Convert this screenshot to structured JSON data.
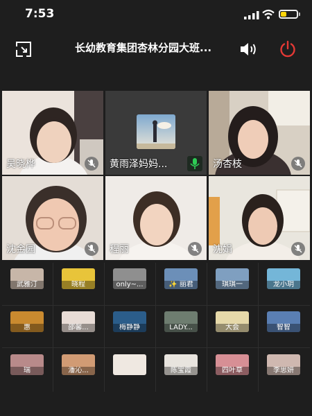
{
  "status": {
    "time": "7:53"
  },
  "header": {
    "title": "长幼教育集团杏林分园大班..."
  },
  "tiles": [
    {
      "name": "吴晓桦",
      "muted": true
    },
    {
      "name": "黄雨泽妈妈...",
      "muted": false
    },
    {
      "name": "汤杏枝",
      "muted": true
    },
    {
      "name": "沈金园",
      "muted": true
    },
    {
      "name": "程丽",
      "muted": true
    },
    {
      "name": "沈娟",
      "muted": true
    }
  ],
  "participants": [
    {
      "label": "武雅汀",
      "color": "#c7b6a8"
    },
    {
      "label": "晓程",
      "color": "#e8c43a"
    },
    {
      "label": "only~...",
      "color": "#8f8f8f"
    },
    {
      "label": "✨ 丽君",
      "color": "#6c8fb8"
    },
    {
      "label": "琪琪一",
      "color": "#7f9fc0"
    },
    {
      "label": "龙小玥",
      "color": "#74b6d8"
    },
    {
      "label": "惠",
      "color": "#c98a2f"
    },
    {
      "label": "邵馨...",
      "color": "#e8dcd6"
    },
    {
      "label": "梅静静",
      "color": "#2b5d8a"
    },
    {
      "label": "LADY...",
      "color": "#6e7d70"
    },
    {
      "label": "大会",
      "color": "#e6d9a9"
    },
    {
      "label": "智智",
      "color": "#5a7fb3"
    },
    {
      "label": "瑞",
      "color": "#b88a8a"
    },
    {
      "label": "潘沁...",
      "color": "#d19b74"
    },
    {
      "label": "",
      "color": "#efe8e1"
    },
    {
      "label": "陈宝霞",
      "color": "#e8e4de"
    },
    {
      "label": "四叶草",
      "color": "#d78f95"
    },
    {
      "label": "李思妍",
      "color": "#cfb8b0"
    }
  ],
  "colors": {
    "background": "#1e1e1e",
    "power": "#e53935",
    "mic_active": "#2ecc55",
    "battery": "#ffd60a"
  },
  "icons": [
    "signal-icon",
    "wifi-icon",
    "battery-icon",
    "minimize-screen-icon",
    "speaker-icon",
    "power-icon",
    "mic-muted-icon",
    "mic-active-icon"
  ]
}
